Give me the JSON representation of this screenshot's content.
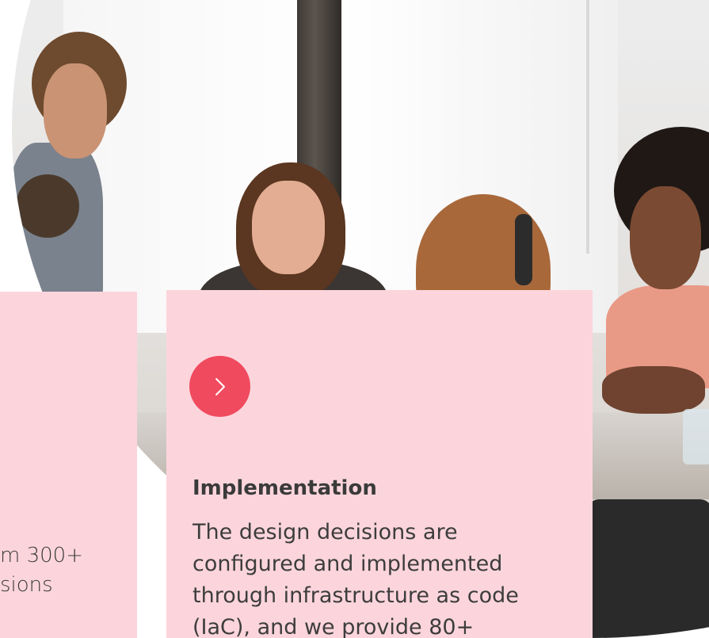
{
  "photo": {
    "description_icon": "team-photo"
  },
  "left_card": {
    "line1": "m 300+",
    "line2": "sions"
  },
  "main_card": {
    "button_icon": "chevron-right-icon",
    "title": "Implementation",
    "body": "The design decisions are configured and implemented through infrastructure as code (IaC), and we provide 80+"
  },
  "colors": {
    "card_background": "#fcd5dc",
    "accent": "#f04a5e",
    "text": "#3a3a3a"
  }
}
